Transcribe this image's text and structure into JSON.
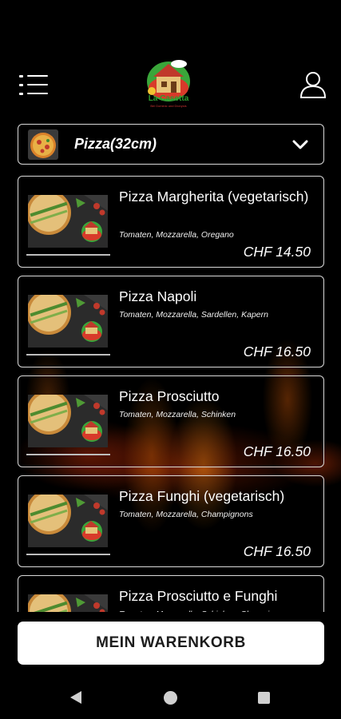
{
  "header": {
    "menu_icon": "menu-list-icon",
    "logo_title": "La Casetta",
    "logo_subtitle": "Bei Dominic und Dionysis",
    "user_icon": "user-profile-icon"
  },
  "category": {
    "selected": "Pizza(32cm)",
    "dropdown_icon": "chevron-down-icon"
  },
  "items": [
    {
      "name": "Pizza Margherita (vegetarisch)",
      "description": "Tomaten, Mozzarella, Oregano",
      "price": "CHF 14.50"
    },
    {
      "name": "Pizza Napoli",
      "description": "Tomaten, Mozzarella, Sardellen, Kapern",
      "price": "CHF 16.50"
    },
    {
      "name": "Pizza Prosciutto",
      "description": "Tomaten, Mozzarella, Schinken",
      "price": "CHF 16.50"
    },
    {
      "name": "Pizza Funghi (vegetarisch)",
      "description": "Tomaten, Mozzarella, Champignons",
      "price": "CHF 16.50"
    },
    {
      "name": "Pizza Prosciutto e Funghi",
      "description": "Tomaten, Mozzarella, Schinken, Champignons",
      "price": ""
    }
  ],
  "cart_button": {
    "label": "MEIN WARENKORB"
  },
  "navbar": {
    "back": "back-triangle-icon",
    "home": "home-circle-icon",
    "recent": "recent-square-icon"
  },
  "colors": {
    "background": "#000000",
    "card_border": "#d9d9d9",
    "button_bg": "#ffffff",
    "logo_green": "#2e9b2e"
  }
}
